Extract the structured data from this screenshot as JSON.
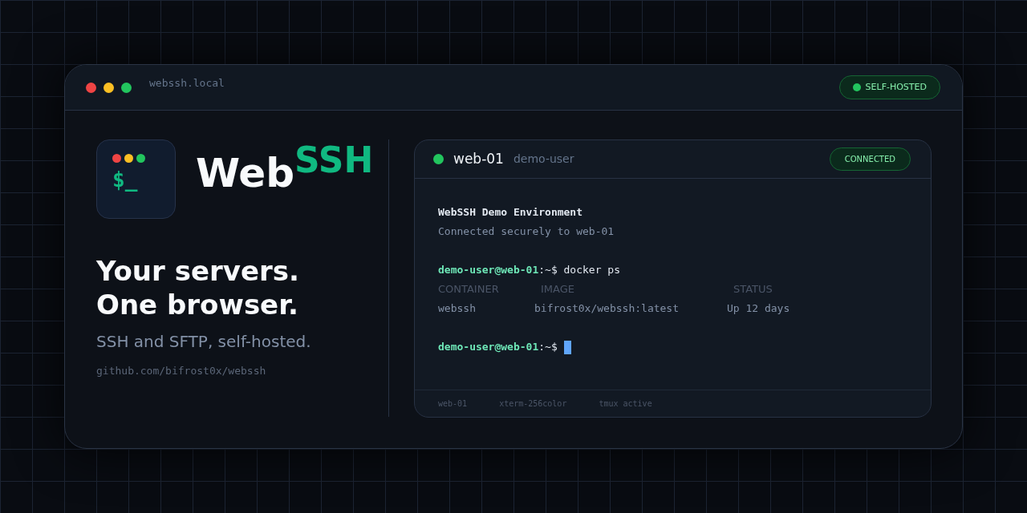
{
  "window": {
    "title": "webssh.local",
    "badge": "SELF-HOSTED"
  },
  "brand": {
    "logo_glyph": "$_",
    "name": "Web",
    "name_suffix": "SSH"
  },
  "hero": {
    "headline": [
      "Your servers.",
      "One browser."
    ],
    "tagline": "SSH and SFTP, self-hosted.",
    "link": "github.com/bifrost0x/webssh"
  },
  "terminal": {
    "host": "web-01",
    "user": "demo-user",
    "status": "CONNECTED",
    "lines": [
      {
        "kind": "heading",
        "text": "WebSSH Demo Environment"
      },
      {
        "kind": "text",
        "text": "Connected securely to web-01"
      },
      {
        "kind": "blank"
      },
      {
        "kind": "prompt",
        "prompt": "demo-user@web-01",
        "suffix": ":~$ docker ps",
        "cursor": false
      },
      {
        "kind": "table_header",
        "cells": [
          "CONTAINER",
          "IMAGE",
          "STATUS"
        ]
      },
      {
        "kind": "table_row",
        "cells": [
          "webssh",
          "bifrost0x/webssh:latest",
          "Up 12 days"
        ]
      },
      {
        "kind": "blank"
      },
      {
        "kind": "prompt",
        "prompt": "demo-user@web-01",
        "suffix": ":~$",
        "cursor": true
      }
    ],
    "footer": [
      "web-01",
      "xterm-256color",
      "tmux active"
    ]
  }
}
